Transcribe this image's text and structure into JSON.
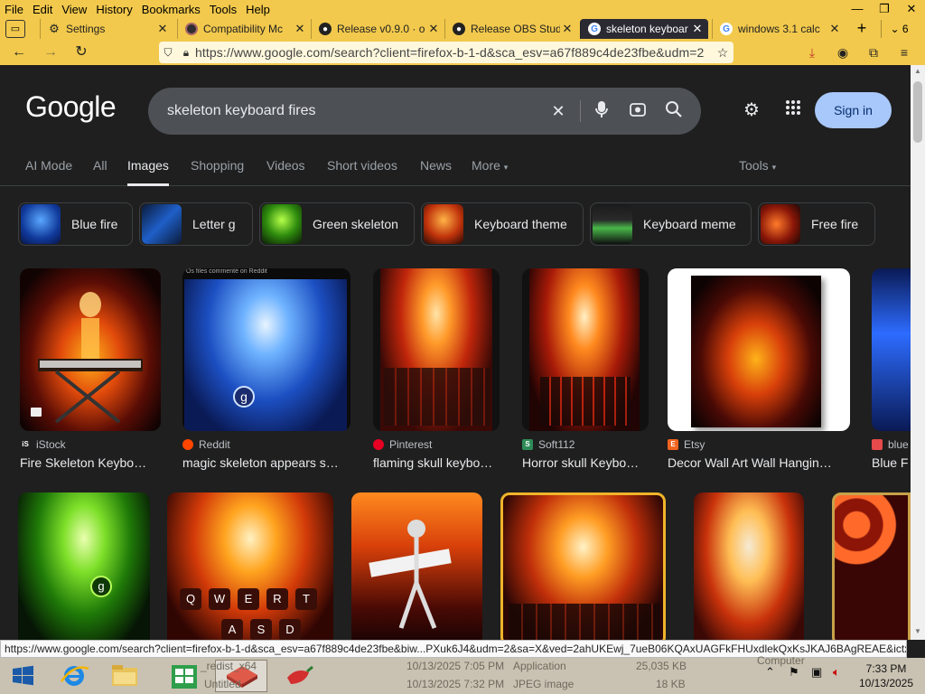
{
  "menubar": [
    "File",
    "Edit",
    "View",
    "History",
    "Bookmarks",
    "Tools",
    "Help"
  ],
  "tabs": [
    {
      "label": "Settings",
      "icon": "gear-icon",
      "color": "#333333"
    },
    {
      "label": "Compatibility Mc",
      "icon": "obs-icon",
      "color": "#333333"
    },
    {
      "label": "Release v0.9.0 · o",
      "icon": "github-icon",
      "color": "#333333"
    },
    {
      "label": "Release OBS Stud",
      "icon": "github-icon",
      "color": "#333333"
    },
    {
      "label": "skeleton keyboar",
      "icon": "google-icon",
      "color": "#2b2a33",
      "active": true
    },
    {
      "label": "windows 3.1 calc",
      "icon": "google-icon",
      "color": "#333333"
    }
  ],
  "tab_count": "6",
  "address": {
    "url": "https://www.google.com/search?client=firefox-b-1-d&sca_esv=a67f889c4de23fbe&udm=2"
  },
  "google": {
    "logo": "Google",
    "query": "skeleton keyboard fires",
    "signin": "Sign in",
    "nav_tabs": [
      "AI Mode",
      "All",
      "Images",
      "Shopping",
      "Videos",
      "Short videos",
      "News",
      "More"
    ],
    "tools": "Tools",
    "chips": [
      "Blue fire",
      "Letter g",
      "Green skeleton",
      "Keyboard theme",
      "Keyboard meme",
      "Free fire"
    ],
    "results_row1": [
      {
        "source": "iStock",
        "title": "Fire Skeleton Keybo…"
      },
      {
        "source": "Reddit",
        "title": "magic skeleton appears s…"
      },
      {
        "source": "Pinterest",
        "title": "flaming skull keybo…"
      },
      {
        "source": "Soft112",
        "title": "Horror skull Keybo…"
      },
      {
        "source": "Etsy",
        "title": "Decor Wall Art Wall Hangin…"
      },
      {
        "source": "blue",
        "title": "Blue F"
      }
    ],
    "reddit_caption": "Os files commenté on Reddit",
    "keycaps": [
      "Q",
      "W",
      "E",
      "R",
      "T",
      "A",
      "S",
      "D"
    ]
  },
  "status_url": "https://www.google.com/search?client=firefox-b-1-d&sca_esv=a67f889c4de23fbe&biw...PXuk6J4&udm=2&sa=X&ved=2ahUKEwj_7ueB06KQAxUAGFkFHUxdlekQxKsJKAJ6BAgREAE&ictx=0",
  "taskbar": {
    "bg_rows": [
      {
        "name": "_redist_x64",
        "date": "10/13/2025 7:05 PM",
        "type": "Application",
        "size": "25,035 KB"
      },
      {
        "name": "Untitled",
        "date": "10/13/2025 7:32 PM",
        "type": "JPEG image",
        "size": "18 KB"
      }
    ],
    "computer": "Computer",
    "time": "7:33 PM",
    "date": "10/13/2025"
  }
}
